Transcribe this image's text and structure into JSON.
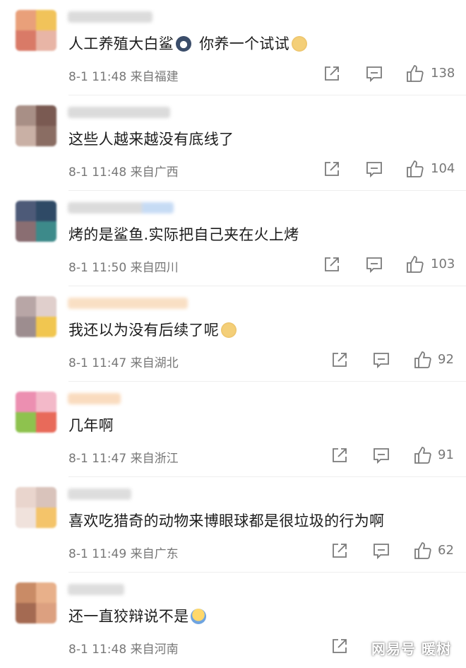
{
  "comments": [
    {
      "text": "人工养殖大白鲨",
      "text_after": "你养一个试试",
      "emoji1": "husky-emoji",
      "emoji2": "doge-emoji",
      "date": "8-1 11:48",
      "location": "来自福建",
      "likes": "138",
      "avatar_colors": [
        "#e9a07a",
        "#f1c35a",
        "#d97a67",
        "#e8b5a6"
      ],
      "name_color": "#c9c9c9"
    },
    {
      "text": "这些人越来越没有底线了",
      "date": "8-1 11:48",
      "location": "来自广西",
      "likes": "104",
      "avatar_colors": [
        "#a88f86",
        "#7a5a52",
        "#c9b0a5",
        "#8a6d63"
      ],
      "name_color": "#c8c8c8"
    },
    {
      "text": "烤的是鲨鱼.实际把自己夹在火上烤",
      "date": "8-1 11:50",
      "location": "来自四川",
      "likes": "103",
      "avatar_colors": [
        "#4d5a78",
        "#2f4a66",
        "#8a6e72",
        "#3d8a8a"
      ],
      "name_color": "#c4cbd6"
    },
    {
      "text": "我还以为没有后续了呢",
      "emoji1": "doge-emoji",
      "date": "8-1 11:47",
      "location": "来自湖北",
      "likes": "92",
      "avatar_colors": [
        "#b8a6a6",
        "#e0cfcc",
        "#9d8d8f",
        "#f1c650"
      ],
      "name_color": "#f6cfa6"
    },
    {
      "text": "几年啊",
      "date": "8-1 11:47",
      "location": "来自浙江",
      "likes": "91",
      "avatar_colors": [
        "#ec8fb1",
        "#f3b9c9",
        "#8ec24e",
        "#e86a5a"
      ],
      "name_color": "#f7c99d"
    },
    {
      "text": "喜欢吃猎奇的动物来博眼球都是很垃圾的行为啊",
      "date": "8-1 11:49",
      "location": "来自广东",
      "likes": "62",
      "avatar_colors": [
        "#e9d5cd",
        "#d9c3bb",
        "#f0e2dc",
        "#f4c46a"
      ],
      "name_color": "#cccccc"
    },
    {
      "text": "还一直狡辩说不是",
      "emoji1": "sweat-emoji",
      "date": "8-1 11:48",
      "location": "来自河南",
      "likes": "",
      "avatar_colors": [
        "#c98b66",
        "#e8b08a",
        "#a46a52",
        "#dca080"
      ],
      "name_color": "#cccccc"
    }
  ],
  "watermark": "网易号 暖树"
}
